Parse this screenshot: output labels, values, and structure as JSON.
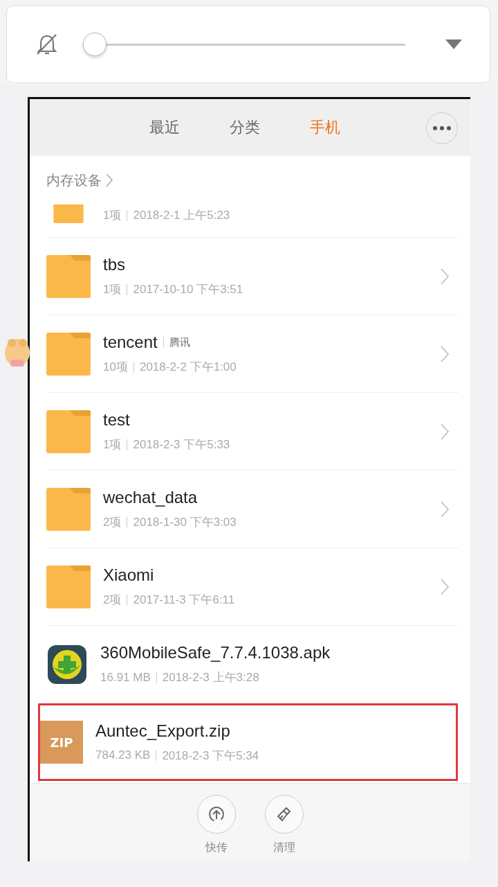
{
  "volume_popup": {
    "muted": true,
    "level": 0
  },
  "tabs": [
    {
      "label": "最近",
      "selected": false
    },
    {
      "label": "分类",
      "selected": false
    },
    {
      "label": "手机",
      "selected": true
    }
  ],
  "breadcrumb": "内存设备",
  "files": [
    {
      "kind": "folder",
      "cut_off": true,
      "count": "1项",
      "date": "2018-2-1 上午5:23",
      "highlighted": false
    },
    {
      "kind": "folder",
      "cut_off": false,
      "name": "tbs",
      "count": "1项",
      "date": "2017-10-10 下午3:51",
      "highlighted": false
    },
    {
      "kind": "folder",
      "cut_off": false,
      "name": "tencent",
      "tag": "腾讯",
      "count": "10项",
      "date": "2018-2-2 下午1:00",
      "highlighted": false,
      "sticker": true
    },
    {
      "kind": "folder",
      "cut_off": false,
      "name": "test",
      "count": "1项",
      "date": "2018-2-3 下午5:33",
      "highlighted": false
    },
    {
      "kind": "folder",
      "cut_off": false,
      "name": "wechat_data",
      "count": "2项",
      "date": "2018-1-30 下午3:03",
      "highlighted": false
    },
    {
      "kind": "folder",
      "cut_off": false,
      "name": "Xiaomi",
      "count": "2项",
      "date": "2017-11-3 下午6:11",
      "highlighted": false
    },
    {
      "kind": "apk",
      "cut_off": false,
      "name": "360MobileSafe_7.7.4.1038.apk",
      "count": "16.91 MB",
      "date": "2018-2-3 上午3:28",
      "highlighted": false
    },
    {
      "kind": "zip",
      "cut_off": false,
      "icon_text": "ZIP",
      "name": "Auntec_Export.zip",
      "count": "784.23 KB",
      "date": "2018-2-3 下午5:34",
      "highlighted": true
    }
  ],
  "bottom_actions": [
    {
      "kind": "send",
      "label": "快传"
    },
    {
      "kind": "clean",
      "label": "清理"
    }
  ]
}
